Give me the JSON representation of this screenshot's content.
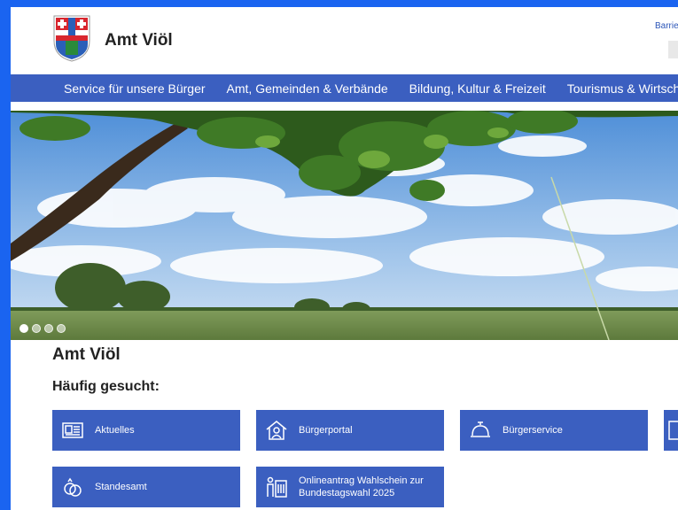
{
  "header": {
    "title": "Amt Viöl",
    "top_link": "Barrie"
  },
  "nav": {
    "items": [
      "Service für unsere Bürger",
      "Amt, Gemeinden & Verbände",
      "Bildung, Kultur & Freizeit",
      "Tourismus & Wirtsch"
    ]
  },
  "slider": {
    "slide_count": 4,
    "active_index": 0
  },
  "main": {
    "heading": "Amt Viöl",
    "subheading": "Häufig gesucht:",
    "tiles": [
      {
        "label": "Aktuelles",
        "icon": "newspaper-icon"
      },
      {
        "label": "Bürgerportal",
        "icon": "house-person-icon"
      },
      {
        "label": "Bürgerservice",
        "icon": "service-bell-icon"
      },
      {
        "label": "",
        "icon": "document-icon"
      },
      {
        "label": "Standesamt",
        "icon": "rings-icon"
      },
      {
        "label": "Onlineantrag Wahlschein zur Bundestagswahl 2025",
        "icon": "ballot-box-icon"
      }
    ]
  },
  "colors": {
    "outer_border": "#1a64f0",
    "nav_bg": "#3b5fc0",
    "tile_bg": "#3b5fc0",
    "text": "#222222"
  }
}
